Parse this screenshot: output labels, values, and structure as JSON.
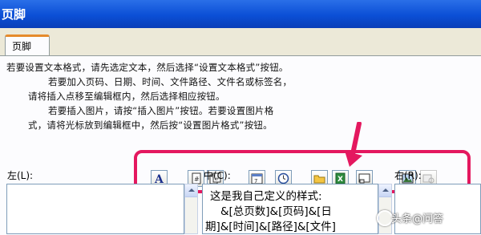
{
  "window": {
    "title": "页脚"
  },
  "tabs": [
    {
      "label": "页脚"
    }
  ],
  "instructions": [
    "若要设置文本格式，请先选定文本，然后选择“设置文本格式”按钮。",
    "若要加入页码、日期、时间、文件路径、文件名或标签名，",
    "请将插入点移至编辑框内，然后选择相应按钮。",
    "若要插入图片，请按“插入图片”按钮。若要设置图片格",
    "式，请将光标放到编辑框中，然后按“设置图片格式”按钮。"
  ],
  "toolbar": [
    {
      "name": "format-text-button",
      "icon": "letter-a-icon"
    },
    {
      "name": "insert-page-number-button",
      "icon": "page-number-icon"
    },
    {
      "name": "insert-total-pages-button",
      "icon": "total-pages-icon"
    },
    {
      "name": "insert-date-button",
      "icon": "calendar-icon"
    },
    {
      "name": "insert-time-button",
      "icon": "clock-icon"
    },
    {
      "name": "insert-file-path-button",
      "icon": "folder-icon"
    },
    {
      "name": "insert-file-name-button",
      "icon": "excel-file-icon"
    },
    {
      "name": "insert-sheet-name-button",
      "icon": "sheet-tab-icon"
    },
    {
      "name": "insert-picture-button",
      "icon": "picture-icon"
    },
    {
      "name": "format-picture-button",
      "icon": "format-picture-icon",
      "disabled": true
    }
  ],
  "sections": {
    "left": {
      "label": "左(L):",
      "content": ""
    },
    "center": {
      "label": "中(C):",
      "content": [
        "这是我自己定义的样式:",
        "&[总页数]&[页码]&[日",
        "期]&[时间]&[路径]&[文件]"
      ]
    },
    "right": {
      "label": "右(R):",
      "content": ""
    }
  },
  "watermark": "头条@问答",
  "colors": {
    "titlebar": "#0b4fd6",
    "highlight": "#e4185f",
    "dialog": "#ece9d8",
    "tab_accent": "#e68b2c"
  }
}
